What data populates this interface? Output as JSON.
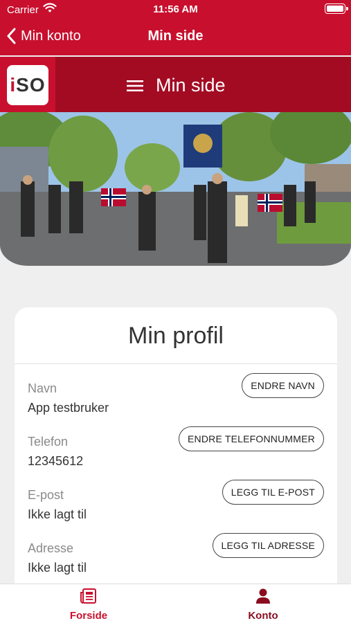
{
  "status_bar": {
    "carrier": "Carrier",
    "time": "11:56 AM",
    "icons": [
      "wifi-icon",
      "battery-icon"
    ]
  },
  "nav": {
    "back_label": "Min konto",
    "title": "Min side"
  },
  "header": {
    "logo_text": "iSO",
    "menu_title": "Min side",
    "menu_icon": "hamburger-icon"
  },
  "profile": {
    "title": "Min profil",
    "fields": [
      {
        "label": "Navn",
        "value": "App testbruker",
        "button": "ENDRE NAVN"
      },
      {
        "label": "Telefon",
        "value": "12345612",
        "button": "ENDRE TELEFONNUMMER"
      },
      {
        "label": "E-post",
        "value": "Ikke lagt til",
        "button": "LEGG TIL E-POST"
      },
      {
        "label": "Adresse",
        "value": "Ikke lagt til",
        "button": "LEGG TIL ADRESSE"
      }
    ]
  },
  "tabs": [
    {
      "label": "Forside",
      "icon": "newspaper-icon"
    },
    {
      "label": "Konto",
      "icon": "person-icon"
    }
  ],
  "colors": {
    "brand_red": "#c8102e",
    "header_dark_red": "#a30b23",
    "konto_tab": "#8a0d1f"
  }
}
